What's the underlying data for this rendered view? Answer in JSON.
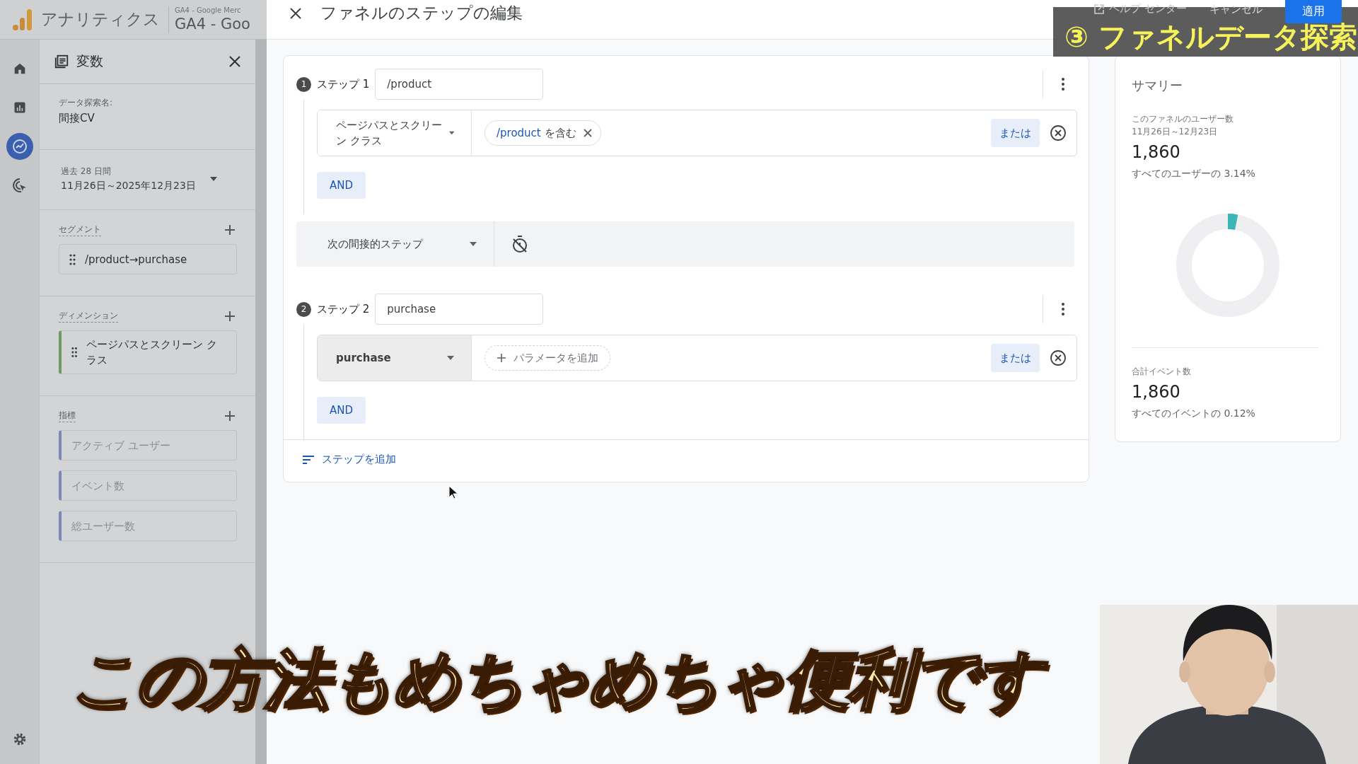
{
  "app_header": {
    "product": "アナリティクス",
    "account": "GA4 - Google Merc",
    "property": "GA4 - Goo"
  },
  "rail": [
    {
      "kind": "home",
      "selected": false
    },
    {
      "kind": "reports",
      "selected": false
    },
    {
      "kind": "explore",
      "selected": true
    },
    {
      "kind": "advertising",
      "selected": false
    }
  ],
  "variables_panel": {
    "title": "変数",
    "name_label": "データ探索名:",
    "name": "間接CV",
    "date_label": "過去 28 日間",
    "date_range": "11月26日～2025年12月23日",
    "sections": [
      {
        "title": "セグメント",
        "items": [
          {
            "kind": "segment",
            "label": "/product→purchase"
          }
        ]
      },
      {
        "title": "ディメンション",
        "items": [
          {
            "kind": "dimension",
            "label": "ページパスとスクリーン クラス"
          }
        ]
      },
      {
        "title": "指標",
        "items": [
          {
            "kind": "metric",
            "label": "アクティブ ユーザー"
          },
          {
            "kind": "metric",
            "label": "イベント数"
          },
          {
            "kind": "metric",
            "label": "総ユーザー数"
          }
        ]
      }
    ]
  },
  "dialog": {
    "title": "ファネルのステップの編集",
    "help": "ヘルプ センター",
    "cancel": "キャンセル",
    "apply": "適用",
    "steps": [
      {
        "number": "1",
        "label": "ステップ 1",
        "name": "/product",
        "condition": {
          "kind": "dimension",
          "field": "ページパスとスクリーン クラス",
          "chip_value": "/product",
          "chip_op": "を含む"
        },
        "or": "または",
        "and": "AND"
      },
      {
        "number": "2",
        "label": "ステップ 2",
        "name": "purchase",
        "condition": {
          "kind": "event",
          "field": "purchase",
          "add_param": "パラメータを追加"
        },
        "or": "または",
        "and": "AND"
      }
    ],
    "connector": {
      "label": "次の間接的ステップ"
    },
    "add_step": "ステップを追加"
  },
  "summary": {
    "title": "サマリー",
    "users_label": "このファネルのユーザー数",
    "users_range": "11月26日～12月23日",
    "users_value": "1,860",
    "users_share": "すべてのユーザーの 3.14%",
    "level": 0.0314,
    "events_label": "合計イベント数",
    "events_value": "1,860",
    "events_share": "すべてのイベントの 0.12%"
  },
  "video_overlay": {
    "banner": "③ ファネルデータ探索",
    "caption": "この方法もめちゃめちゃ便利です"
  }
}
